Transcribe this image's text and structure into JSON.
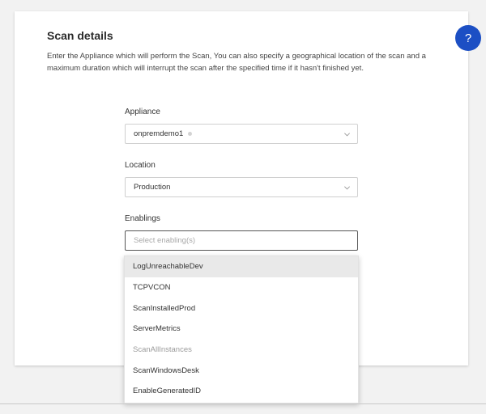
{
  "scan_details": {
    "title": "Scan details",
    "description": "Enter the Appliance which will perform the Scan, You can also specify a geographical location of the scan and a maximum duration which will interrupt the scan after the specified time if it hasn't finished yet."
  },
  "appliance": {
    "label": "Appliance",
    "value": "onpremdemo1",
    "status_color": "#d3d3d3"
  },
  "location": {
    "label": "Location",
    "value": "Production"
  },
  "enablings": {
    "label": "Enablings",
    "placeholder": "Select enabling(s)",
    "options": [
      {
        "label": "LogUnreachableDev",
        "state": "highlighted"
      },
      {
        "label": "TCPVCON",
        "state": "normal"
      },
      {
        "label": "ScanInstalledProd",
        "state": "normal"
      },
      {
        "label": "ServerMetrics",
        "state": "normal"
      },
      {
        "label": "ScanAllInstances",
        "state": "disabled"
      },
      {
        "label": "ScanWindowsDesk",
        "state": "normal"
      },
      {
        "label": "EnableGeneratedID",
        "state": "normal"
      }
    ]
  },
  "help": {
    "label": "?",
    "icon": "help-icon"
  },
  "colors": {
    "accent": "#1c4fc4",
    "highlight": "#e9e9e9",
    "card_bg": "#ffffff",
    "page_bg": "#f2f2f2"
  }
}
